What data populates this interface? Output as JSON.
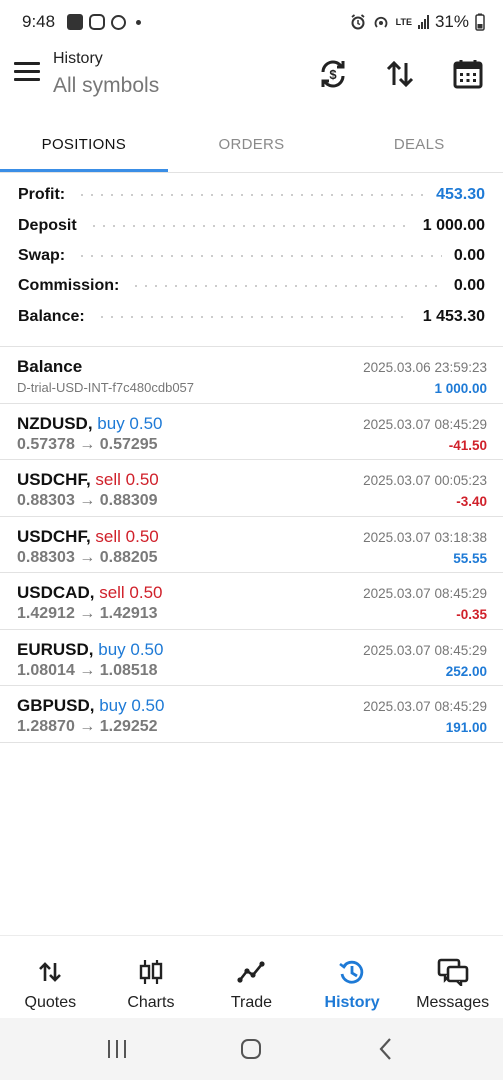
{
  "status_bar": {
    "time": "9:48",
    "network": "LTE",
    "battery": "31%"
  },
  "header": {
    "title": "History",
    "subtitle": "All symbols",
    "icons": [
      "menu-icon",
      "currency-exchange-icon",
      "sort-icon",
      "calendar-icon"
    ]
  },
  "tabs": [
    {
      "label": "POSITIONS",
      "active": true
    },
    {
      "label": "ORDERS",
      "active": false
    },
    {
      "label": "DEALS",
      "active": false
    }
  ],
  "summary": [
    {
      "label": "Profit:",
      "value": "453.30"
    },
    {
      "label": "Deposit",
      "value": "1 000.00"
    },
    {
      "label": "Swap:",
      "value": "0.00"
    },
    {
      "label": "Commission:",
      "value": "0.00"
    },
    {
      "label": "Balance:",
      "value": "1 453.30"
    }
  ],
  "balance_entry": {
    "title": "Balance",
    "subtitle": "D-trial-USD-INT-f7c480cdb057",
    "time": "2025.03.06 23:59:23",
    "amount": "1 000.00"
  },
  "deals": [
    {
      "symbol": "NZDUSD,",
      "side": "buy 0.50",
      "type": "buy",
      "prices": "0.57378 → 0.57295",
      "time": "2025.03.07 08:45:29",
      "profit": "-41.50"
    },
    {
      "symbol": "USDCHF,",
      "side": "sell 0.50",
      "type": "sell",
      "prices": "0.88303 → 0.88309",
      "time": "2025.03.07 00:05:23",
      "profit": "-3.40"
    },
    {
      "symbol": "USDCHF,",
      "side": "sell 0.50",
      "type": "sell",
      "prices": "0.88303 → 0.88205",
      "time": "2025.03.07 03:18:38",
      "profit": "55.55"
    },
    {
      "symbol": "USDCAD,",
      "side": "sell 0.50",
      "type": "sell",
      "prices": "1.42912 → 1.42913",
      "time": "2025.03.07 08:45:29",
      "profit": "-0.35"
    },
    {
      "symbol": "EURUSD,",
      "side": "buy 0.50",
      "type": "buy",
      "prices": "1.08014 → 1.08518",
      "time": "2025.03.07 08:45:29",
      "profit": "252.00"
    },
    {
      "symbol": "GBPUSD,",
      "side": "buy 0.50",
      "type": "buy",
      "prices": "1.28870 → 1.29252",
      "time": "2025.03.07 08:45:29",
      "profit": "191.00"
    }
  ],
  "bottom_nav": [
    {
      "label": "Quotes",
      "icon": "quotes-icon",
      "active": false
    },
    {
      "label": "Charts",
      "icon": "candlestick-icon",
      "active": false
    },
    {
      "label": "Trade",
      "icon": "trade-line-icon",
      "active": false
    },
    {
      "label": "History",
      "icon": "history-icon",
      "active": true
    },
    {
      "label": "Messages",
      "icon": "messages-icon",
      "active": false
    }
  ],
  "colors": {
    "accent_blue": "#1e7ad6",
    "loss_red": "#d0202a",
    "tab_indicator": "#3a8ee6"
  }
}
